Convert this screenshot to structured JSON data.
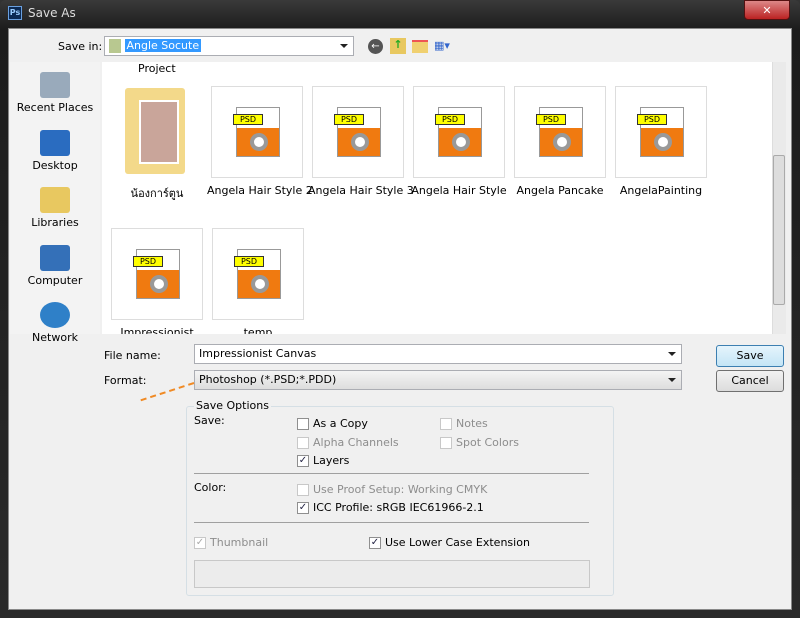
{
  "window": {
    "title": "Save As",
    "close_label": "✕"
  },
  "save_in": {
    "label": "Save in:",
    "value": "Angle Socute"
  },
  "places": [
    {
      "label": "Recent Places",
      "icon": "recent-places-icon"
    },
    {
      "label": "Desktop",
      "icon": "desktop-icon"
    },
    {
      "label": "Libraries",
      "icon": "libraries-icon"
    },
    {
      "label": "Computer",
      "icon": "computer-icon"
    },
    {
      "label": "Network",
      "icon": "network-icon"
    }
  ],
  "files": {
    "partial_top": "Project",
    "items": [
      {
        "name": "น้องการ์ตูน",
        "type": "folder"
      },
      {
        "name": "Angela Hair Style 2",
        "type": "psd"
      },
      {
        "name": "Angela Hair Style 3",
        "type": "psd"
      },
      {
        "name": "Angela Hair Style",
        "type": "psd"
      },
      {
        "name": "Angela Pancake",
        "type": "psd"
      },
      {
        "name": "AngelaPainting",
        "type": "psd"
      },
      {
        "name": "Impressionist",
        "type": "psd"
      },
      {
        "name": "temp",
        "type": "psd"
      }
    ],
    "psd_tag": "PSD"
  },
  "filename": {
    "label": "File name:",
    "value": "Impressionist Canvas"
  },
  "format": {
    "label": "Format:",
    "value": "Photoshop (*.PSD;*.PDD)"
  },
  "buttons": {
    "save": "Save",
    "cancel": "Cancel"
  },
  "options": {
    "title": "Save Options",
    "save_label": "Save:",
    "as_copy": {
      "label": "As a Copy",
      "checked": false
    },
    "notes": {
      "label": "Notes",
      "checked": false,
      "disabled": true
    },
    "alpha": {
      "label": "Alpha Channels",
      "checked": false,
      "disabled": true
    },
    "spot": {
      "label": "Spot Colors",
      "checked": false,
      "disabled": true
    },
    "layers": {
      "label": "Layers",
      "checked": true
    },
    "color_label": "Color:",
    "proof": {
      "label": "Use Proof Setup:  Working CMYK",
      "checked": false,
      "disabled": true
    },
    "icc": {
      "label": "ICC Profile:  sRGB IEC61966-2.1",
      "checked": true
    },
    "thumbnail": {
      "label": "Thumbnail",
      "checked": true,
      "disabled": true
    },
    "lowercase": {
      "label": "Use Lower Case Extension",
      "checked": true
    }
  },
  "colors": {
    "accent_arrow": "#f08a24",
    "selection": "#3399ff"
  }
}
